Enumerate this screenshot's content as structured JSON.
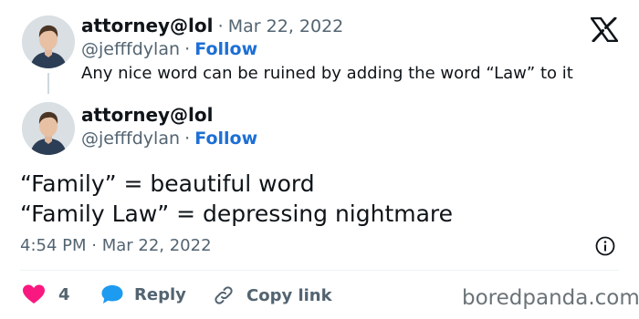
{
  "quoted_tweet": {
    "display_name": "attorney@lol",
    "date_sep": "·",
    "date": "Mar 22, 2022",
    "handle": "@jefffdylan",
    "handle_sep": "·",
    "follow_label": "Follow",
    "text": "Any nice word can be ruined by adding the word “Law” to it"
  },
  "main_tweet": {
    "display_name": "attorney@lol",
    "handle": "@jefffdylan",
    "handle_sep": "·",
    "follow_label": "Follow",
    "text_line_1": "“Family” = beautiful word",
    "text_line_2": "“Family Law” = depressing nightmare",
    "timestamp": "4:54 PM · Mar 22, 2022"
  },
  "actions": {
    "like_count": "4",
    "reply_label": "Reply",
    "copy_link_label": "Copy link"
  },
  "watermark": "boredpanda.com",
  "icons": {
    "platform": "x-logo-icon",
    "info": "info-icon",
    "like": "heart-icon",
    "reply": "speech-bubble-icon",
    "copy": "link-icon"
  },
  "colors": {
    "heart": "#f91880",
    "reply_bubble": "#1d9bf0",
    "follow": "#1d6fd6"
  }
}
